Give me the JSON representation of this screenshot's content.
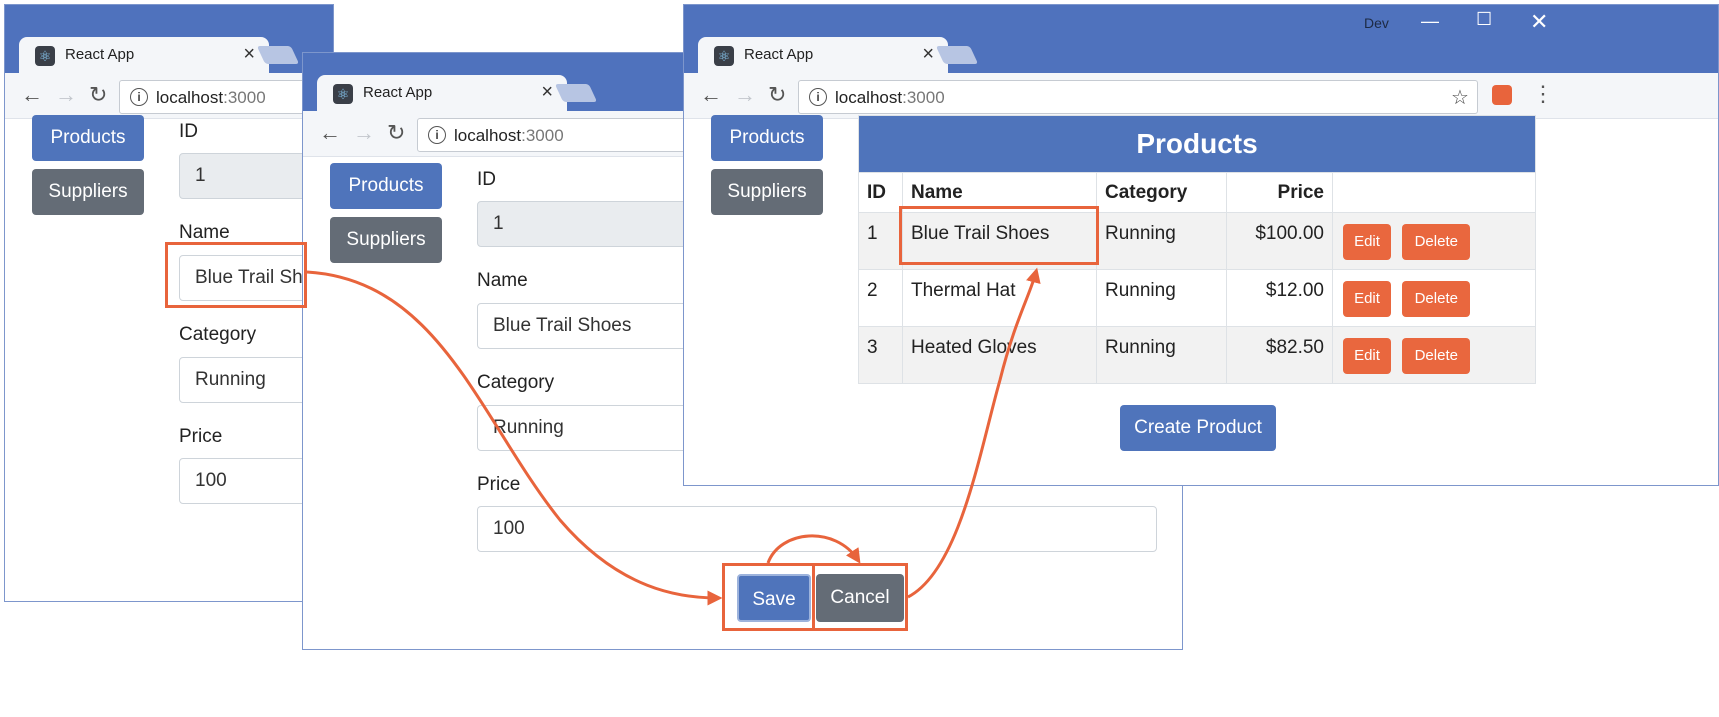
{
  "browser": {
    "tab_title": "React App",
    "tab_close": "×",
    "url_host": "localhost",
    "url_port": ":3000",
    "info_glyph": "i",
    "profile_label": "Dev"
  },
  "nav": {
    "products_label": "Products",
    "suppliers_label": "Suppliers"
  },
  "form": {
    "id_label": "ID",
    "id_value": "1",
    "name_label": "Name",
    "name_value": "Blue Trail Shoes",
    "category_label": "Category",
    "category_value": "Running",
    "price_label": "Price",
    "price_value": "100",
    "save_label": "Save",
    "cancel_label": "Cancel"
  },
  "table": {
    "title": "Products",
    "headers": [
      "ID",
      "Name",
      "Category",
      "Price"
    ],
    "rows": [
      {
        "id": "1",
        "name": "Blue Trail Shoes",
        "category": "Running",
        "price": "$100.00"
      },
      {
        "id": "2",
        "name": "Thermal Hat",
        "category": "Running",
        "price": "$12.00"
      },
      {
        "id": "3",
        "name": "Heated Gloves",
        "category": "Running",
        "price": "$82.50"
      }
    ],
    "edit_label": "Edit",
    "delete_label": "Delete",
    "create_label": "Create Product"
  },
  "icons": {
    "back": "back-arrow-icon",
    "forward": "forward-arrow-icon",
    "reload": "reload-icon",
    "info": "info-icon",
    "star": "star-icon",
    "extension": "extension-icon",
    "menu": "menu-dots-icon",
    "minimize": "minimize-icon",
    "maximize": "maximize-icon",
    "close": "close-icon"
  },
  "colors": {
    "chrome_blue": "#4f72bd",
    "primary": "#4f74bb",
    "secondary": "#646c76",
    "danger": "#e9673e",
    "annotation": "#e8643c"
  }
}
